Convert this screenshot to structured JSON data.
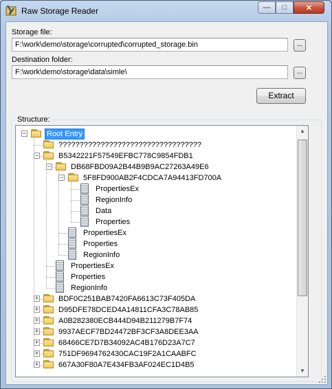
{
  "window": {
    "title": "Raw Storage Reader"
  },
  "captions": {
    "minimize": "—",
    "maximize": "□",
    "close": "✕"
  },
  "storage": {
    "label": "Storage file:",
    "value": "F:\\work\\demo\\storage\\corrupted\\corrupted_storage.bin",
    "browse": "..."
  },
  "destination": {
    "label": "Destination folder:",
    "value": "F:\\work\\demo\\storage\\data\\simle\\",
    "browse": "..."
  },
  "extract_label": "Extract",
  "structure": {
    "label": "Structure:",
    "nodes": [
      {
        "text": "Root Entry",
        "level": 0,
        "icon": "folder-icon",
        "expander": "-",
        "selected": true
      },
      {
        "text": "??????????????????????????????????",
        "level": 1,
        "icon": "folder-icon",
        "expander": ""
      },
      {
        "text": "B5342221F57549EFBC778C9854FDB1",
        "level": 1,
        "icon": "folder-icon",
        "expander": "-"
      },
      {
        "text": "DB68FBD09A2B44B9B9AC27263A49E6",
        "level": 2,
        "icon": "folder-icon",
        "expander": "-"
      },
      {
        "text": "5F8FD900AB2F4CDCA7A94413FD700A",
        "level": 3,
        "icon": "folder-icon",
        "expander": "-"
      },
      {
        "text": "PropertiesEx",
        "level": 4,
        "icon": "stream-icon",
        "expander": ""
      },
      {
        "text": "RegionInfo",
        "level": 4,
        "icon": "stream-icon",
        "expander": ""
      },
      {
        "text": "Data",
        "level": 4,
        "icon": "stream-icon",
        "expander": ""
      },
      {
        "text": "Properties",
        "level": 4,
        "icon": "stream-icon",
        "expander": ""
      },
      {
        "text": "PropertiesEx",
        "level": 3,
        "icon": "stream-icon",
        "expander": ""
      },
      {
        "text": "Properties",
        "level": 3,
        "icon": "stream-icon",
        "expander": ""
      },
      {
        "text": "RegionInfo",
        "level": 3,
        "icon": "stream-icon",
        "expander": ""
      },
      {
        "text": "PropertiesEx",
        "level": 2,
        "icon": "stream-icon",
        "expander": ""
      },
      {
        "text": "Properties",
        "level": 2,
        "icon": "stream-icon",
        "expander": ""
      },
      {
        "text": "RegionInfo",
        "level": 2,
        "icon": "stream-icon",
        "expander": ""
      },
      {
        "text": "BDF0C251BAB7420FA6613C73F405DA",
        "level": 1,
        "icon": "folder-icon",
        "expander": "+"
      },
      {
        "text": "D95DFE78DCED4A14811CFA3C78AB85",
        "level": 1,
        "icon": "folder-icon",
        "expander": "+"
      },
      {
        "text": "A0B282380ECB444D94B211279B7F74",
        "level": 1,
        "icon": "folder-icon",
        "expander": "+"
      },
      {
        "text": "9937AECF7BD24472BF3CF3A8DEE3AA",
        "level": 1,
        "icon": "folder-icon",
        "expander": "+"
      },
      {
        "text": "68466CE7D7B34092AC4B176D23A7C7",
        "level": 1,
        "icon": "folder-icon",
        "expander": "+"
      },
      {
        "text": "751DF9694762430CAC19F2A1CAABFC",
        "level": 1,
        "icon": "folder-icon",
        "expander": "+"
      },
      {
        "text": "667A30F80A7E434FB3AF024EC1D4B5",
        "level": 1,
        "icon": "folder-icon",
        "expander": "+"
      }
    ]
  },
  "scrollbar": {
    "up": "▲",
    "down": "▼"
  }
}
